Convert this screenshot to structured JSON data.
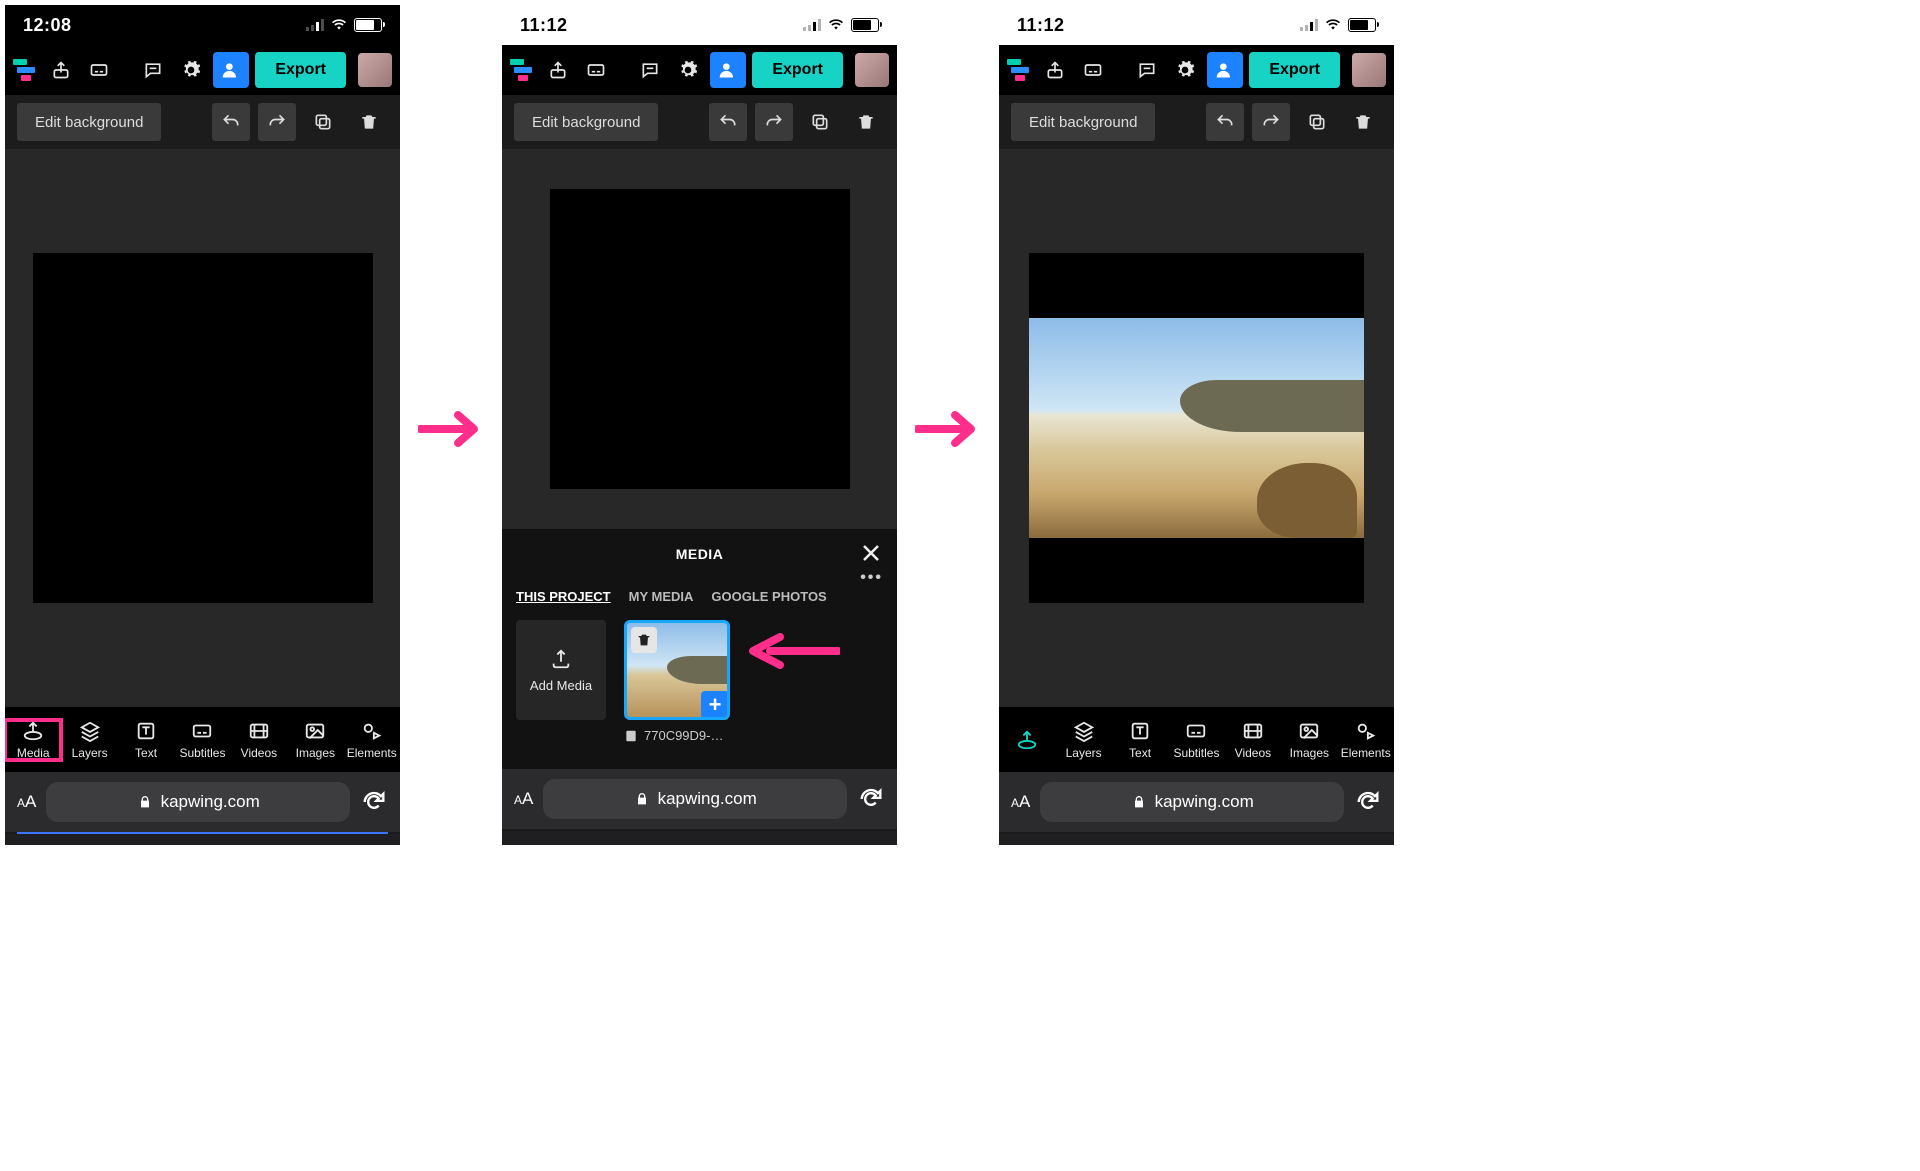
{
  "screens": [
    {
      "time": "12:08"
    },
    {
      "time": "11:12"
    },
    {
      "time": "11:12"
    }
  ],
  "toolbar": {
    "export_label": "Export"
  },
  "edit_row": {
    "edit_bg": "Edit background"
  },
  "media_panel": {
    "title": "MEDIA",
    "tabs": [
      "THIS PROJECT",
      "MY MEDIA",
      "GOOGLE PHOTOS"
    ],
    "add_media": "Add Media",
    "thumb_filename": "770C99D9-…"
  },
  "tool_tabs": [
    "Media",
    "Layers",
    "Text",
    "Subtitles",
    "Videos",
    "Images",
    "Elements"
  ],
  "safari": {
    "url": "kapwing.com"
  }
}
